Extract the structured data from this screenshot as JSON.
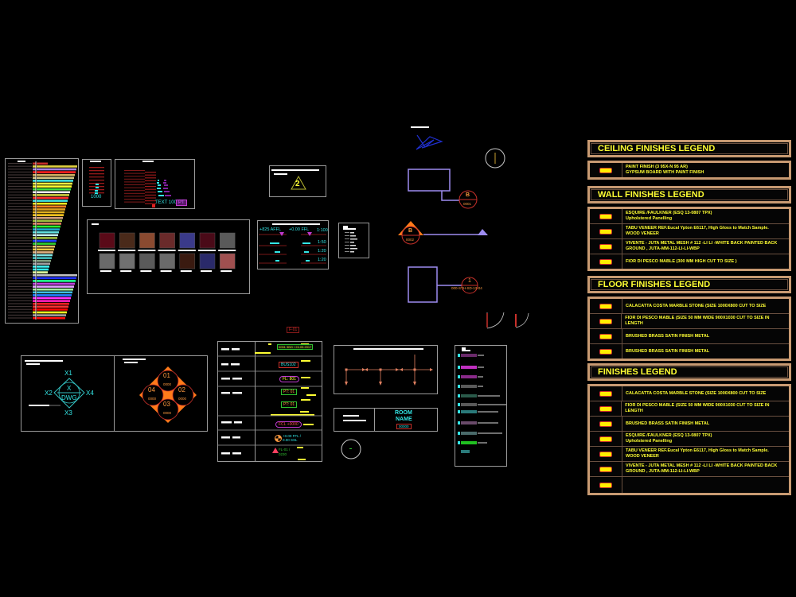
{
  "canvas": {
    "background": "#000000"
  },
  "colors": {
    "legend_border": "#c89a72",
    "legend_text": "#ffff33",
    "cyan": "#33e6e6",
    "orange": "#ff7a1a",
    "purple": "#9d8cf0",
    "red": "#c8302a",
    "magenta": "#c03ad0"
  },
  "legends": {
    "ceiling": {
      "title": "CEILING FINISHES LEGEND",
      "items": [
        {
          "line1": "PAINT FINISH (3 95X-N 95 AR)",
          "line2": "GYPSUM BOARD WITH PAINT FINISH"
        }
      ]
    },
    "wall": {
      "title": "WALL FINISHES LEGEND",
      "items": [
        {
          "line1": "ESQUIRE /FAULKNER (ESQ 13-0807 TPX)",
          "line2": "Upholstered Panelling"
        },
        {
          "line1": "TABU VENEER REF.Eucal Ypton E6117, High Gloss to Match Sample.",
          "line2": "WOOD VENEER"
        },
        {
          "line1": "VIVENTE - JUTA METAL MESH # 112 -LI LI -WHITE BACK PAINTED BACK",
          "line2": "GROUND , JUTA-MM-112-LI-LI-WBP"
        },
        {
          "line1": "FIOR DI PESCO MABLE (300 MM HIGH CUT TO SIZE )",
          "line2": ""
        }
      ]
    },
    "floor": {
      "title": "FLOOR FINISHES LEGEND",
      "items": [
        {
          "line1": "CALACATTA COSTA MARBLE STONE (SIZE 1000X800 CUT TO SIZE",
          "line2": ""
        },
        {
          "line1": "FIOR DI PESCO MABLE (SIZE 50 MM WIDE 900X1030 CUT TO SIZE IN LENGTH",
          "line2": ""
        },
        {
          "line1": "BRUSHED BRASS SATIN FINISH METAL",
          "line2": ""
        },
        {
          "line1": "BRUSHED BRASS SATIN FINISH METAL",
          "line2": ""
        }
      ]
    },
    "finishes": {
      "title": "FINISHES LEGEND",
      "items": [
        {
          "line1": "CALACATTA COSTA MARBLE STONE (SIZE 1000X800 CUT TO SIZE",
          "line2": ""
        },
        {
          "line1": "FIOR DI PESCO MABLE (SIZE 50 MM WIDE 900X1030 CUT TO SIZE IN LENGTH",
          "line2": ""
        },
        {
          "line1": "BRUSHED BRASS SATIN FINISH METAL",
          "line2": ""
        },
        {
          "line1": "ESQUIRE /FAULKNER (ESQ 13-0807 TPX)",
          "line2": "Upholstered Panelling"
        },
        {
          "line1": "TABU VENEER REF.Eucal Ypton E6117, High Gloss to Match Sample.",
          "line2": "WOOD VENEER"
        },
        {
          "line1": "VIVENTE - JUTA METAL MESH # 112 -LI LI -WHITE BACK PAINTED BACK",
          "line2": "GROUND , JUTA-MM-112-LI-LI-WBP"
        },
        {
          "line1": "",
          "line2": ""
        }
      ]
    }
  },
  "text_styles": {
    "sample_number": "1000",
    "sample_text": "TEXT 100",
    "pt_tag": "PT"
  },
  "level_marks": {
    "labels": [
      "+825 AFFL",
      "+0.00 FFL"
    ],
    "scales": [
      "1:100",
      "1:50",
      "1:20",
      "1:20"
    ]
  },
  "revision_marker": {
    "number": "2"
  },
  "section_marks": {
    "top": {
      "letter": "B",
      "number": "0001"
    },
    "mid": {
      "letter": "B",
      "number": "0002"
    },
    "detail": {
      "number": "1",
      "ref": "000-STH-SD-13-04"
    }
  },
  "elevation_keys": {
    "single": {
      "labels": [
        "X1",
        "X2",
        "X3",
        "X4"
      ],
      "center_top": "X",
      "center_bottom": "DWG"
    },
    "quad": [
      {
        "num": "01",
        "sub": "0000"
      },
      {
        "num": "02",
        "sub": "0000"
      },
      {
        "num": "03",
        "sub": "0000"
      },
      {
        "num": "04",
        "sub": "0000"
      }
    ]
  },
  "tags_table": {
    "header_tag": "F-01",
    "tags": [
      "0051 3BG / 24.05.2017",
      "BUS102",
      "FL: 801",
      "PT: 01",
      "PT: 01",
      "FCL +0000",
      "+0.00 FFL / 0.00 SSL",
      "FL-01 / 0230"
    ]
  },
  "room_tag": {
    "name_line1": "ROOM",
    "name_line2": "NAME",
    "number": "00000"
  }
}
